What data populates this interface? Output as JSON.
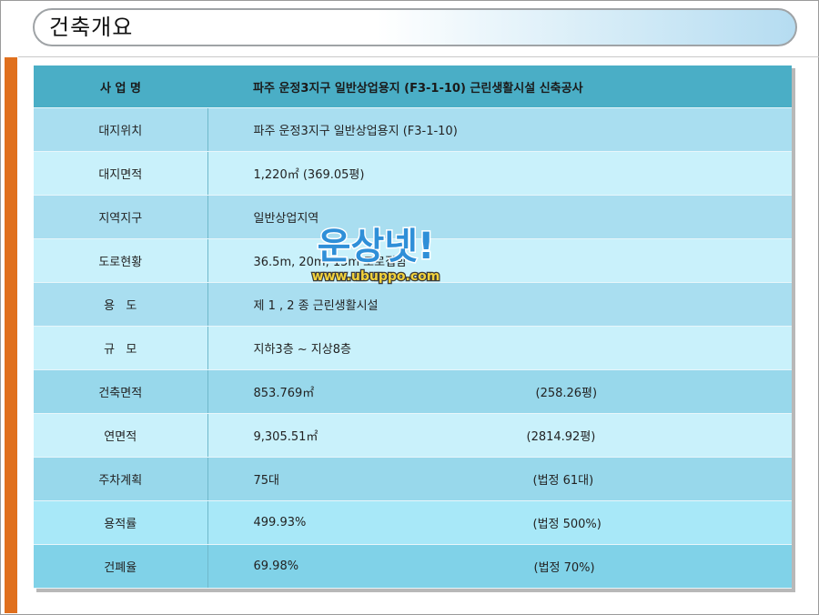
{
  "page": {
    "title": "건축개요"
  },
  "table": {
    "header": {
      "label": "사 업 명",
      "value": "파주 운정3지구 일반상업용지 (F3-1-10) 근린생활시설 신축공사"
    },
    "rows": [
      {
        "label": "대지위치",
        "value": "파주 운정3지구 일반상업용지 (F3-1-10)",
        "extra": ""
      },
      {
        "label": "대지면적",
        "value": "1,220㎡  (369.05평)",
        "extra": ""
      },
      {
        "label": "지역지구",
        "value": "일반상업지역",
        "extra": ""
      },
      {
        "label": "도로현황",
        "value": "36.5m,  20m,  15m  도로접함",
        "extra": ""
      },
      {
        "label": "용   도",
        "value": "제 1 , 2 종 근린생활시설",
        "extra": ""
      },
      {
        "label": "규   모",
        "value": "지하3층 ~ 지상8층",
        "extra": ""
      },
      {
        "label": "건축면적",
        "value": "853.769㎡",
        "extra": "(258.26평)"
      },
      {
        "label": "연면적",
        "value": "9,305.51㎡",
        "extra": "(2814.92평)"
      },
      {
        "label": "주차계획",
        "value": "75대",
        "extra": "(법정 61대)"
      },
      {
        "label": "용적률",
        "value": "499.93%",
        "extra": "(법정 500%)"
      },
      {
        "label": "건폐율",
        "value": "69.98%",
        "extra": "(법정 70%)"
      }
    ]
  },
  "watermark": {
    "brand": "운상넷!",
    "url": "www.ubuppo.com"
  },
  "colors": {
    "accent": "#e0701e",
    "header_bg": "#4aaec6"
  }
}
